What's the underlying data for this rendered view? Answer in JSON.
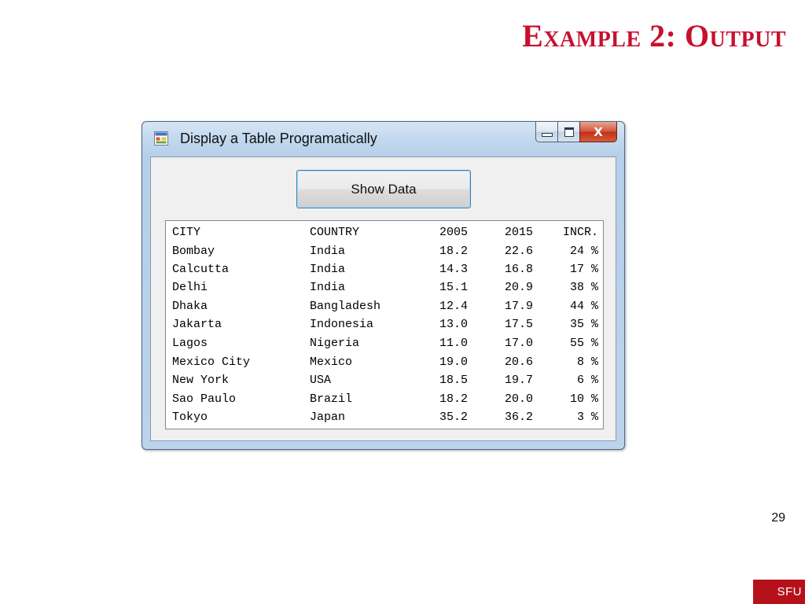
{
  "slide": {
    "title": "Example 2: Output",
    "page_number": "29",
    "logo_text": "SFU"
  },
  "window": {
    "title": "Display a Table Programatically",
    "icon": "app-form-icon",
    "caption_buttons": {
      "minimize_icon": "minimize-icon",
      "maximize_icon": "maximize-icon",
      "close_icon": "close-icon",
      "close_glyph": "X"
    },
    "show_button_label": "Show Data"
  },
  "table": {
    "headers": {
      "city": "CITY",
      "country": "COUNTRY",
      "y2005": "2005",
      "y2015": "2015",
      "incr": "INCR."
    },
    "rows": [
      {
        "city": "Bombay",
        "country": "India",
        "y2005": "18.2",
        "y2015": "22.6",
        "incr": "24 %"
      },
      {
        "city": "Calcutta",
        "country": "India",
        "y2005": "14.3",
        "y2015": "16.8",
        "incr": "17 %"
      },
      {
        "city": "Delhi",
        "country": "India",
        "y2005": "15.1",
        "y2015": "20.9",
        "incr": "38 %"
      },
      {
        "city": "Dhaka",
        "country": "Bangladesh",
        "y2005": "12.4",
        "y2015": "17.9",
        "incr": "44 %"
      },
      {
        "city": "Jakarta",
        "country": "Indonesia",
        "y2005": "13.0",
        "y2015": "17.5",
        "incr": "35 %"
      },
      {
        "city": "Lagos",
        "country": "Nigeria",
        "y2005": "11.0",
        "y2015": "17.0",
        "incr": "55 %"
      },
      {
        "city": "Mexico City",
        "country": "Mexico",
        "y2005": "19.0",
        "y2015": "20.6",
        "incr": "8 %"
      },
      {
        "city": "New York",
        "country": "USA",
        "y2005": "18.5",
        "y2015": "19.7",
        "incr": "6 %"
      },
      {
        "city": "Sao Paulo",
        "country": "Brazil",
        "y2005": "18.2",
        "y2015": "20.0",
        "incr": "10 %"
      },
      {
        "city": "Tokyo",
        "country": "Japan",
        "y2005": "35.2",
        "y2015": "36.2",
        "incr": "3 %"
      }
    ]
  },
  "colors": {
    "title_red": "#c8102e",
    "logo_red": "#b5111b",
    "button_border_blue": "#3c7fb1",
    "close_button_red": "#c2301a"
  }
}
